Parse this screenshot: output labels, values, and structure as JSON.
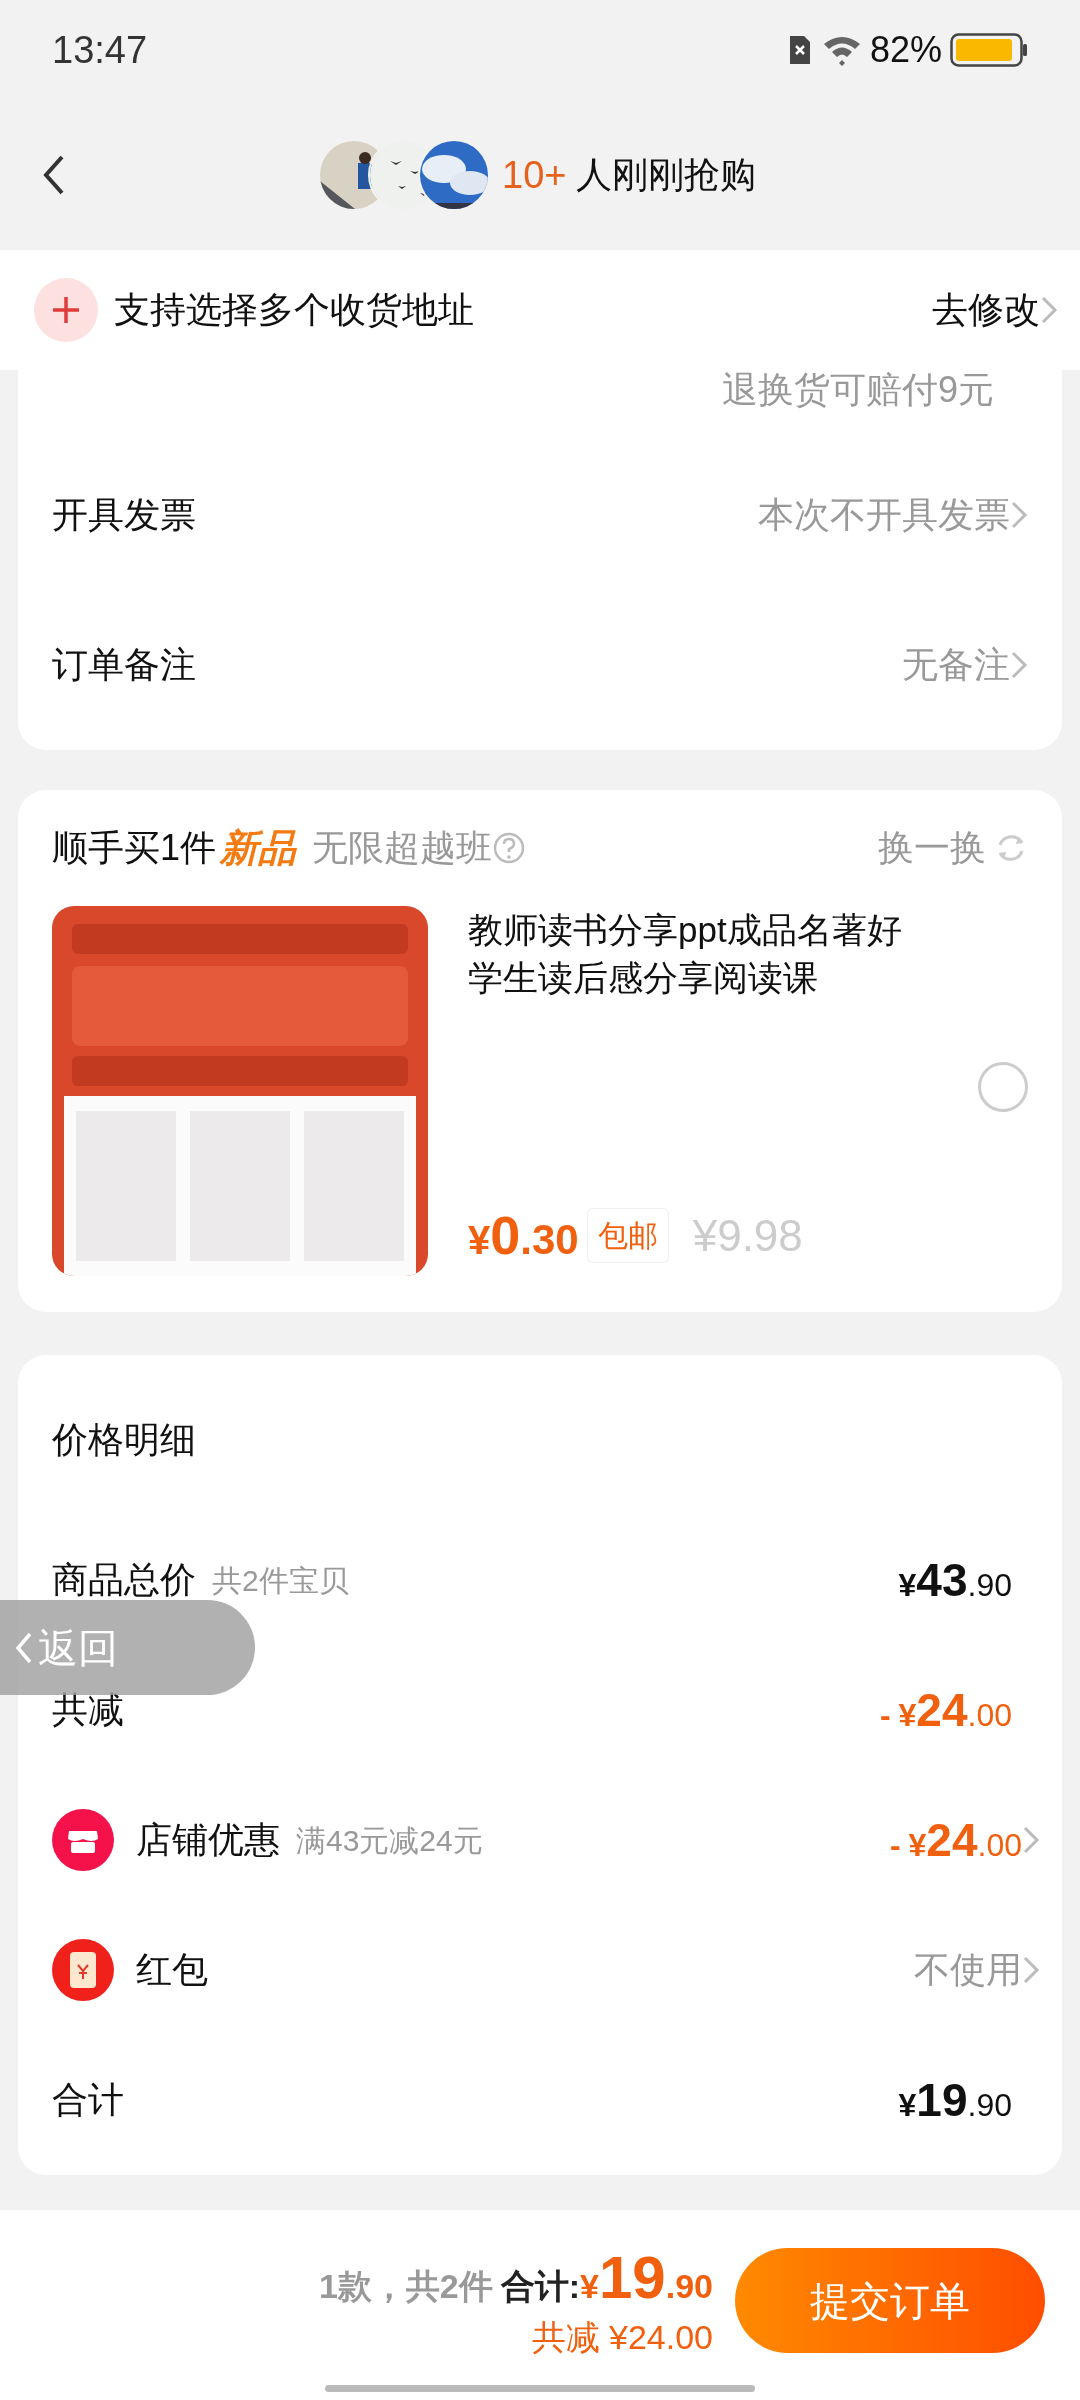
{
  "status_bar": {
    "time": "13:47",
    "battery": "82%"
  },
  "header": {
    "count": "10+",
    "text": "人刚刚抢购"
  },
  "address_bar": {
    "text": "支持选择多个收货地址",
    "action": "去修改"
  },
  "order_options": {
    "partial_value": "退换货可赔付9元",
    "rows": [
      {
        "label": "开具发票",
        "value": "本次不开具发票"
      },
      {
        "label": "订单备注",
        "value": "无备注"
      }
    ]
  },
  "add_on": {
    "title": "顺手买1件",
    "tag": "新品",
    "subtitle": "无限超越班",
    "action": "换一换",
    "product": {
      "title": "教师读书分享ppt成品名著好学生读后感分享阅读课",
      "price": {
        "currency": "¥",
        "whole": "0",
        "fraction": ".30"
      },
      "shipping": "包邮",
      "original_price": "¥9.98",
      "selected": false
    }
  },
  "price_details": {
    "title": "价格明细",
    "rows": [
      {
        "kind": "plain",
        "label": "商品总价",
        "note": "共2件宝贝",
        "amount": {
          "currency": "¥",
          "whole": "43",
          "fraction": ".90"
        },
        "chevron": false
      },
      {
        "kind": "discount",
        "label": "共减",
        "amount": {
          "sign": "-",
          "currency": "¥",
          "whole": "24",
          "fraction": ".00"
        },
        "chevron": false
      },
      {
        "kind": "shop",
        "label": "店铺优惠",
        "note": "满43元减24元",
        "amount": {
          "sign": "-",
          "currency": "¥",
          "whole": "24",
          "fraction": ".00"
        },
        "chevron": true
      },
      {
        "kind": "red_packet",
        "label": "红包",
        "value": "不使用",
        "chevron": true
      },
      {
        "kind": "plain",
        "label": "合计",
        "amount": {
          "currency": "¥",
          "whole": "19",
          "fraction": ".90"
        },
        "chevron": false
      }
    ]
  },
  "floating_back": {
    "label": "返回"
  },
  "bottom_bar": {
    "summary": "1款，共2件",
    "total_label": "合计:",
    "total": {
      "currency": "¥",
      "whole": "19",
      "fraction": ".90"
    },
    "saved": "共减 ¥24.00",
    "submit": "提交订单"
  }
}
